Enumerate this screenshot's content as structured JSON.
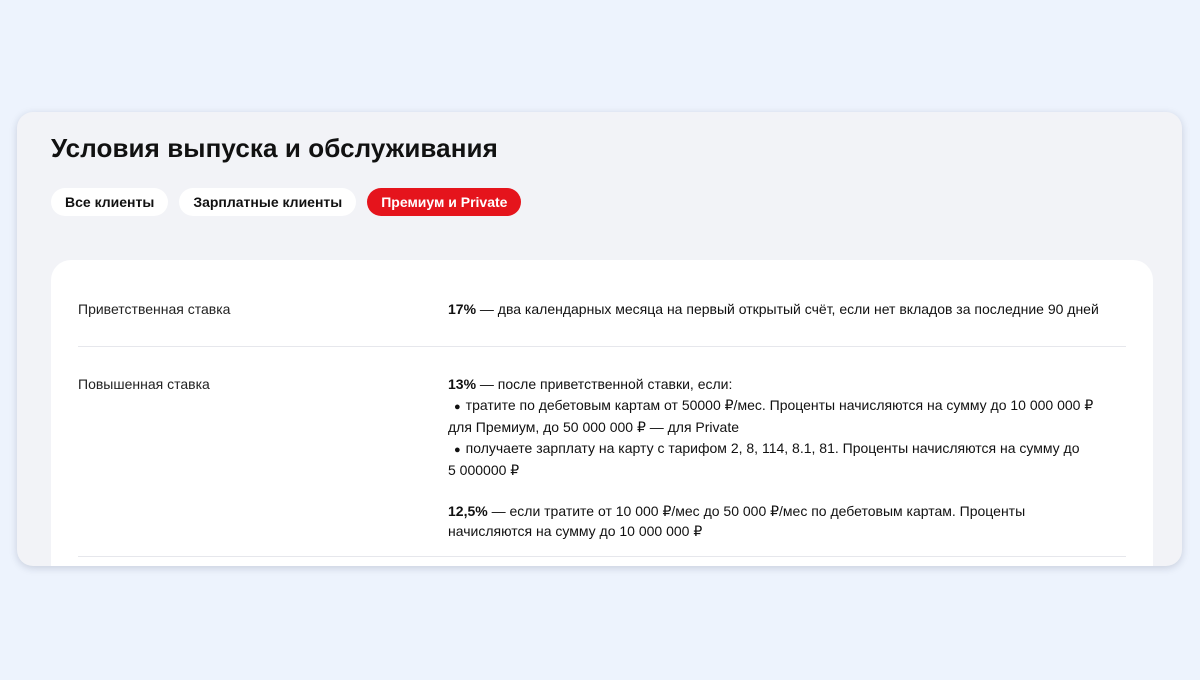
{
  "section": {
    "title": "Условия выпуска и обслуживания"
  },
  "tabs": [
    {
      "label": "Все клиенты",
      "active": false
    },
    {
      "label": "Зарплатные клиенты",
      "active": false
    },
    {
      "label": "Премиум и Private",
      "active": true
    }
  ],
  "colors": {
    "accent": "#e5141c",
    "page_background": "#edf3fd",
    "panel_background": "#f2f3f7",
    "card_background": "#ffffff"
  },
  "rows": [
    {
      "label": "Приветственная ставка",
      "rate": "17%",
      "text": " — два календарных месяца на первый открытый счёт, если нет вкладов за последние 90 дней"
    },
    {
      "label": "Повышенная ставка",
      "rate": "13%",
      "text": " — после приветственной ставки, если:",
      "bullets": [
        "тратите по дебетовым картам от 50000 ₽/мес. Проценты начисляются на сумму до 10 000 000 ₽",
        "для Премиум, до 50 000 000 ₽ — для Private",
        "получаете зарплату на карту с тарифом 2, 8, 114, 8.1, 81. Проценты начисляются на сумму до",
        "5 000000 ₽"
      ],
      "second_rate": "12,5%",
      "second_text": " — если тратите от 10 000 ₽/мес до 50 000 ₽/мес по дебетовым картам. Проценты",
      "second_text_line2": "начисляются на сумму до 10 000 000 ₽"
    }
  ]
}
